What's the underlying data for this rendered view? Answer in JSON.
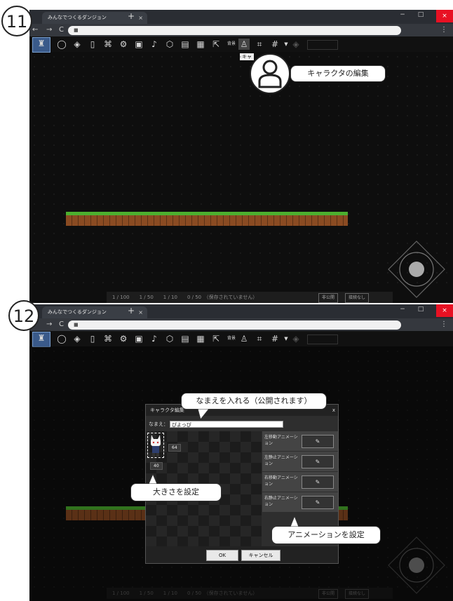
{
  "step11": {
    "number": "11",
    "browser": {
      "tab_title": "みんなでつくるダンジョン",
      "tab_close": "×",
      "new_tab": "+",
      "nav_back": "←",
      "nav_forward": "→",
      "nav_reload": "C",
      "menu": "⋮",
      "window_min": "−",
      "window_max": "□",
      "window_close": "×"
    },
    "toolbar": {
      "tb_text_label": "背景",
      "hint_label": "キャ"
    },
    "callout": "キャラクタの編集",
    "status": {
      "counts": "1 / 100　　1 / 50　　1 / 10　　0 / 50　（保存されていません）",
      "badge_private": "非公開",
      "badge_unconnected": "接続なし"
    }
  },
  "step12": {
    "number": "12",
    "browser": {
      "tab_title": "みんなでつくるダンジョン",
      "tab_close": "×",
      "new_tab": "+",
      "nav_forward": "→",
      "nav_reload": "C",
      "menu": "⋮",
      "window_min": "−",
      "window_max": "□",
      "window_close": "×"
    },
    "toolbar": {
      "tb_text_label": "背景"
    },
    "dialog": {
      "title": "キャラクタ編集",
      "close": "x",
      "name_label": "なまえ：",
      "name_value": "ぴよっぴ",
      "width": "64",
      "height": "40",
      "animations": [
        {
          "label": "左移動アニメーション"
        },
        {
          "label": "左静止アニメーション"
        },
        {
          "label": "右移動アニメーション"
        },
        {
          "label": "右静止アニメーション"
        }
      ],
      "ok": "OK",
      "cancel": "キャンセル"
    },
    "callouts": {
      "name": "なまえを入れる（公開されます）",
      "size": "大きさを設定",
      "animation": "アニメーションを設定"
    },
    "status": {
      "counts": "1 / 100　　1 / 50　　1 / 10　　0 / 50　（保存されていません）",
      "badge_private": "非公開",
      "badge_unconnected": "接続なし"
    }
  }
}
